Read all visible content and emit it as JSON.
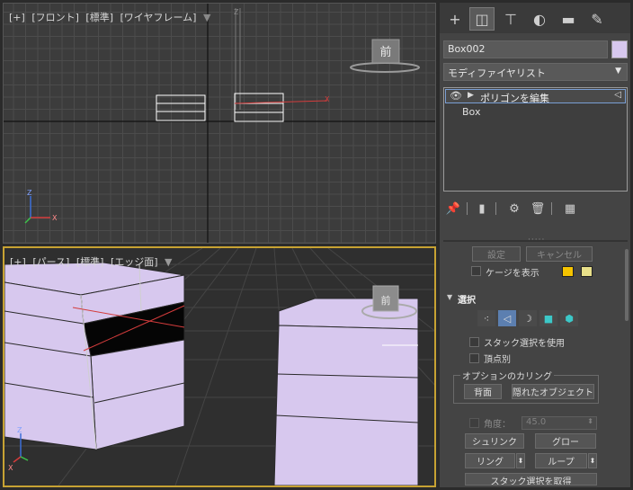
{
  "viewport_top": {
    "label": [
      "[+]",
      "[フロント]",
      "[標準]",
      "[ワイヤフレーム]"
    ],
    "viewcube_label": "前",
    "axis_labels": {
      "z": "Z",
      "x": "X"
    }
  },
  "viewport_persp": {
    "label": [
      "[+]",
      "[パース]",
      "[標準]",
      "[エッジ面]"
    ],
    "viewcube_label": "前",
    "axis_labels": {
      "z": "Z",
      "x": "X"
    }
  },
  "panel": {
    "tabs": [
      {
        "icon": "plus-icon",
        "glyph": "+"
      },
      {
        "icon": "modify-icon",
        "glyph": "◫"
      },
      {
        "icon": "hierarchy-icon",
        "glyph": "⊤"
      },
      {
        "icon": "motion-icon",
        "glyph": "◐"
      },
      {
        "icon": "display-icon",
        "glyph": "▬"
      },
      {
        "icon": "utilities-icon",
        "glyph": "✎"
      }
    ],
    "object_name": "Box002",
    "object_color": "#d7c8ee",
    "modifier_list_label": "モディファイヤリスト",
    "stack": {
      "modifier": "ポリゴンを編集",
      "base": "Box"
    },
    "buttons": {
      "settings": "設定",
      "cancel": "キャンセル",
      "cage_label": "ケージを表示",
      "cage_color_1": "#f5c400",
      "cage_color_2": "#e8e08a"
    },
    "selection": {
      "title": "選択",
      "use_stack_selection": "スタック選択を使用",
      "by_vertex": "頂点別",
      "culling_group": "オプションのカリング",
      "backface": "背面",
      "occluded": "隠れたオブジェクト",
      "angle_label": "角度：",
      "angle_value": "45.0",
      "shrink": "シュリンク",
      "grow": "グロー",
      "ring": "リング",
      "loop": "ループ",
      "get_stack_selection": "スタック選択を取得"
    }
  },
  "colors": {
    "accent": "#5c7fb0",
    "active_viewport_border": "#c7a233",
    "box_face": "#d7c8ee"
  }
}
